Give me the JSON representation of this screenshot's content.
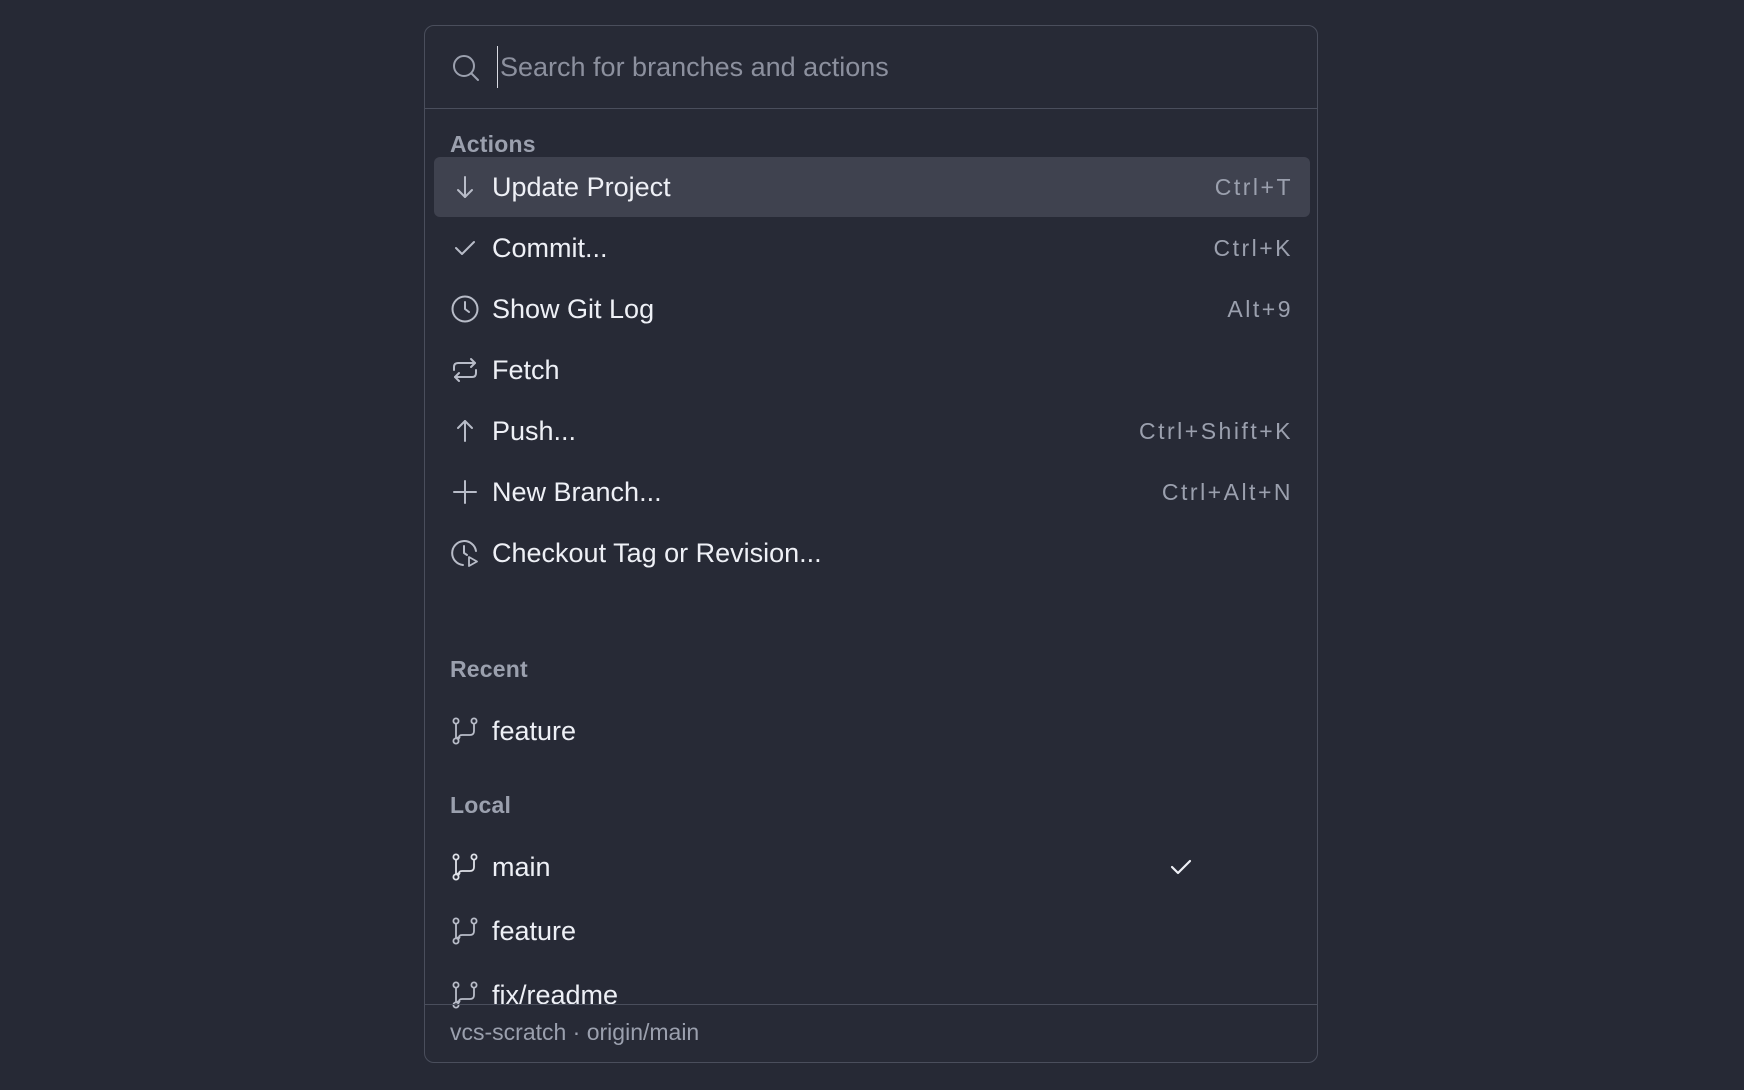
{
  "search": {
    "placeholder": "Search for branches and actions",
    "icon": "search-icon"
  },
  "sections": {
    "actions_label": "Actions",
    "recent_label": "Recent",
    "local_label": "Local"
  },
  "actions": [
    {
      "label": "Update Project",
      "shortcut": "Ctrl+T",
      "icon": "arrow-down-icon",
      "selected": true
    },
    {
      "label": "Commit...",
      "shortcut": "Ctrl+K",
      "icon": "check-icon"
    },
    {
      "label": "Show Git Log",
      "shortcut": "Alt+9",
      "icon": "clock-icon"
    },
    {
      "label": "Fetch",
      "shortcut": "",
      "icon": "refresh-icon"
    },
    {
      "label": "Push...",
      "shortcut": "Ctrl+Shift+K",
      "icon": "arrow-up-icon"
    },
    {
      "label": "New Branch...",
      "shortcut": "Ctrl+Alt+N",
      "icon": "plus-icon"
    },
    {
      "label": "Checkout Tag or Revision...",
      "shortcut": "",
      "icon": "clock-play-icon"
    }
  ],
  "recent": [
    {
      "label": "feature",
      "icon": "branch-icon"
    }
  ],
  "local": [
    {
      "label": "main",
      "icon": "branch-icon",
      "current": true
    },
    {
      "label": "feature",
      "icon": "branch-icon"
    },
    {
      "label": "fix/readme",
      "icon": "branch-icon"
    }
  ],
  "footer": {
    "text": "vcs-scratch · origin/main"
  },
  "colors": {
    "background": "#262935",
    "panel": "#272a36",
    "selected_row": "#3f424f",
    "border": "#4a4e5c",
    "text": "#eef0f6",
    "muted_text": "#9ba0ae"
  }
}
